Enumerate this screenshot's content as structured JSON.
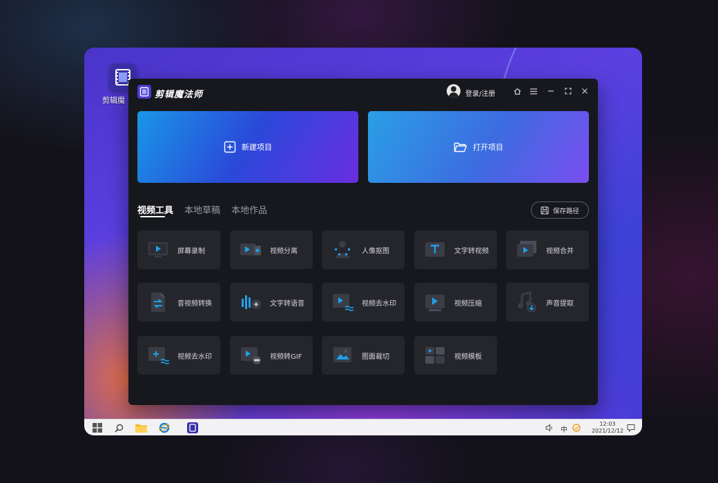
{
  "desktop": {
    "shortcut_label": "剪辑魔"
  },
  "app": {
    "title": "剪辑魔法师",
    "login_label": "登录/注册",
    "new_project": "新建项目",
    "open_project": "打开项目",
    "tabs": [
      "视频工具",
      "本地草稿",
      "本地作品"
    ],
    "active_tab": 0,
    "save_path_label": "保存路径",
    "tools": [
      {
        "label": "屏幕录制",
        "icon": "screen-record-icon"
      },
      {
        "label": "视频分离",
        "icon": "video-split-icon"
      },
      {
        "label": "人像抠图",
        "icon": "portrait-cutout-icon"
      },
      {
        "label": "文字转视频",
        "icon": "text-to-video-icon"
      },
      {
        "label": "视频合并",
        "icon": "video-merge-icon"
      },
      {
        "label": "音视频转换",
        "icon": "av-convert-icon"
      },
      {
        "label": "文字转语音",
        "icon": "text-to-speech-icon"
      },
      {
        "label": "视频去水印",
        "icon": "video-remove-watermark-icon"
      },
      {
        "label": "视频压缩",
        "icon": "video-compress-icon"
      },
      {
        "label": "声音提取",
        "icon": "audio-extract-icon"
      },
      {
        "label": "视频去水印",
        "icon": "video-remove-watermark-icon"
      },
      {
        "label": "视频转GIF",
        "icon": "video-to-gif-icon"
      },
      {
        "label": "图面裁切",
        "icon": "image-crop-icon"
      },
      {
        "label": "视频模板",
        "icon": "video-template-icon"
      }
    ]
  },
  "taskbar": {
    "ime": "中",
    "time": "12:03",
    "date": "2021/12/12"
  },
  "colors": {
    "accent": "#1fa0e8",
    "window_bg": "#17181d",
    "tile_bg": "#25262c"
  }
}
